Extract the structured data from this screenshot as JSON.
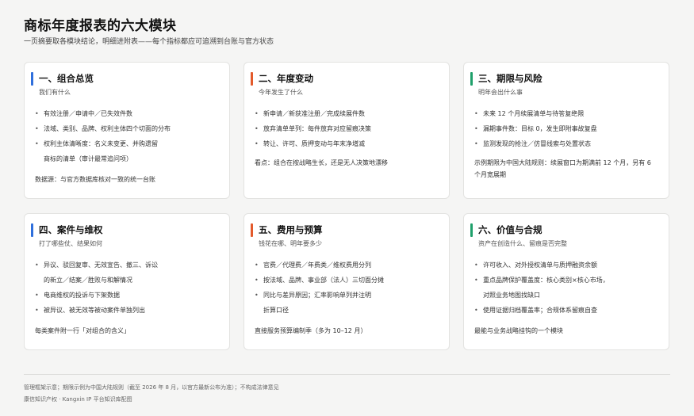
{
  "header": {
    "title": "商标年度报表的六大模块",
    "subtitle": "一页摘要取各模块结论，明细进附表——每个指标都应可追溯到台账与官方状态"
  },
  "colors": {
    "blue": "#2f6fdc",
    "orange": "#e35a2b",
    "green": "#1fa06b"
  },
  "cards": [
    {
      "title": "一、组合总览",
      "subtitle": "我们有什么",
      "bullets": [
        [
          "有效注册／申请中／已失效件数"
        ],
        [
          "法域、类别、品牌、权利主体四个切面的分布"
        ],
        [
          "权利主体清晰度：名义未变更、并购遗留",
          "商标的清单（审计最常追问项）"
        ]
      ],
      "note": "数据源：与官方数据库核对一致的统一台账"
    },
    {
      "title": "二、年度变动",
      "subtitle": "今年发生了什么",
      "bullets": [
        [
          "新申请／新获准注册／完成续展件数"
        ],
        [
          "放弃清单单列：每件放弃对应留痕决策"
        ],
        [
          "转让、许可、质押变动与年末净增减"
        ]
      ],
      "note": "看点：组合在按战略生长，还是无人决策地漂移"
    },
    {
      "title": "三、期限与风险",
      "subtitle": "明年会出什么事",
      "bullets": [
        [
          "未来 12 个月续展清单与待答复绝限"
        ],
        [
          "漏期事件数：目标 0，发生即附事故复盘"
        ],
        [
          "监测发现的抢注／仿冒线索与处置状态"
        ]
      ],
      "note": "示例期限为中国大陆规则：续展窗口为期满前 12 个月，另有 6 个月宽展期"
    },
    {
      "title": "四、案件与维权",
      "subtitle": "打了哪些仗、结果如何",
      "bullets": [
        [
          "异议、驳回复审、无效宣告、撤三、诉讼",
          "的新立／结案／胜败与和解情况"
        ],
        [
          "电商维权的投诉与下架数据"
        ],
        [
          "被异议、被无效等被动案件单独列出"
        ]
      ],
      "note": "每类案件附一行「对组合的含义」"
    },
    {
      "title": "五、费用与预算",
      "subtitle": "钱花在哪、明年要多少",
      "bullets": [
        [
          "官费／代理费／年费类／维权费用分列"
        ],
        [
          "按法域、品牌、事业部（法人）三切面分摊"
        ],
        [
          "同比与差异原因；汇率影响单列并注明",
          "折算口径"
        ]
      ],
      "note": "直接服务预算编制季（多为 10–12 月）"
    },
    {
      "title": "六、价值与合规",
      "subtitle": "资产在创造什么、留痕是否完整",
      "bullets": [
        [
          "许可收入、对外授权清单与质押融资余额"
        ],
        [
          "重点品牌保护覆盖度：核心类别×核心市场，",
          "对照业务地图找缺口"
        ],
        [
          "使用证据归档覆盖率；合规体系留痕自查"
        ]
      ],
      "note": "最能与业务战略挂钩的一个模块"
    }
  ],
  "footer": {
    "line1": "管理框架示意；期限示例为中国大陆规则（截至 2026 年 8 月，以官方最新公布为准）；不构成法律意见",
    "line2": "康信知识产权 · Kangxin IP 平台知识库配图"
  }
}
